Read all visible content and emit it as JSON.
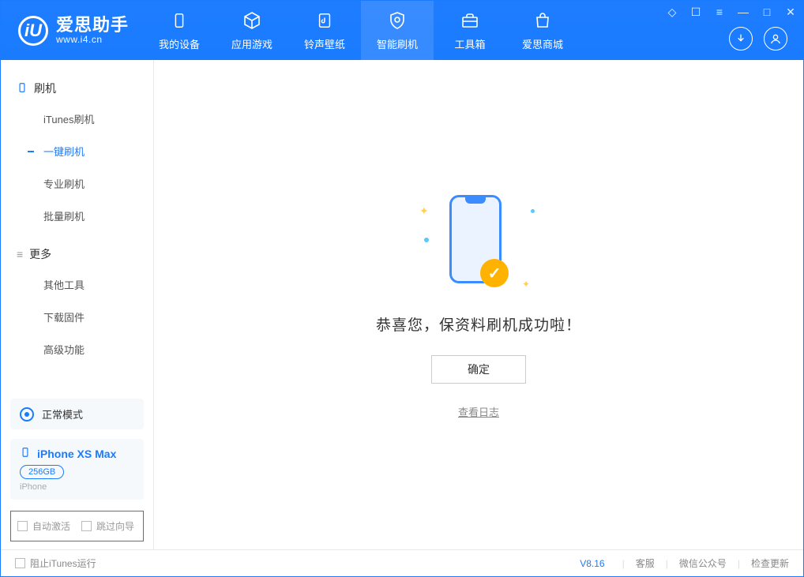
{
  "app": {
    "title": "爱思助手",
    "subtitle": "www.i4.cn",
    "logo_letter": "iU"
  },
  "nav": {
    "tabs": [
      {
        "label": "我的设备",
        "icon": "device-icon"
      },
      {
        "label": "应用游戏",
        "icon": "cube-icon"
      },
      {
        "label": "铃声壁纸",
        "icon": "music-icon"
      },
      {
        "label": "智能刷机",
        "icon": "shield-icon",
        "active": true
      },
      {
        "label": "工具箱",
        "icon": "toolbox-icon"
      },
      {
        "label": "爱思商城",
        "icon": "shop-icon"
      }
    ]
  },
  "sidebar": {
    "group1": {
      "title": "刷机",
      "items": [
        "iTunes刷机",
        "一键刷机",
        "专业刷机",
        "批量刷机"
      ],
      "active_index": 1
    },
    "group2": {
      "title": "更多",
      "items": [
        "其他工具",
        "下载固件",
        "高级功能"
      ]
    },
    "mode": {
      "label": "正常模式"
    },
    "device": {
      "name": "iPhone XS Max",
      "storage": "256GB",
      "type": "iPhone"
    },
    "options": {
      "auto_activate": "自动激活",
      "skip_guide": "跳过向导"
    }
  },
  "main": {
    "success_message": "恭喜您，保资料刷机成功啦！",
    "ok_button": "确定",
    "view_log": "查看日志"
  },
  "statusbar": {
    "block_itunes": "阻止iTunes运行",
    "version": "V8.16",
    "links": [
      "客服",
      "微信公众号",
      "检查更新"
    ]
  }
}
